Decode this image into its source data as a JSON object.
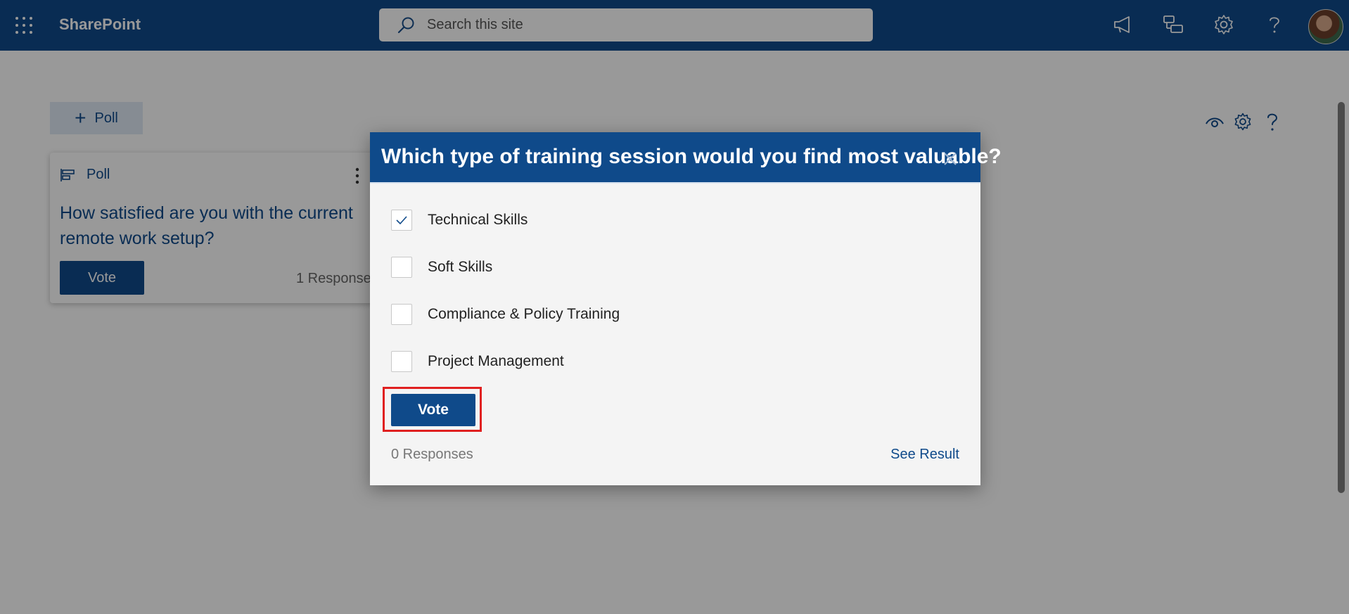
{
  "suite_bar": {
    "app_name": "SharePoint",
    "search": {
      "placeholder": "Search this site",
      "value": ""
    },
    "icons": [
      "waffle-icon",
      "megaphone-icon",
      "share-feedback-icon",
      "gear-icon",
      "help-icon",
      "avatar"
    ]
  },
  "page": {
    "add_button_label": "Poll",
    "right_tool_icons": [
      "eye-icon",
      "gear-icon",
      "help-icon"
    ],
    "poll_card": {
      "header_label": "Poll",
      "question": "How satisfied are you with the current remote work setup?",
      "vote_label": "Vote",
      "responses": "1 Response"
    }
  },
  "dialog": {
    "title": "Which type of training session would you find most valuable?",
    "options": [
      {
        "label": "Technical Skills",
        "checked": true
      },
      {
        "label": "Soft Skills",
        "checked": false
      },
      {
        "label": "Compliance & Policy Training",
        "checked": false
      },
      {
        "label": "Project Management",
        "checked": false
      }
    ],
    "vote_label": "Vote",
    "responses": "0 Responses",
    "see_result": "See Result"
  },
  "colors": {
    "brand_blue": "#0f4a8a",
    "highlight_red": "#e02020"
  }
}
